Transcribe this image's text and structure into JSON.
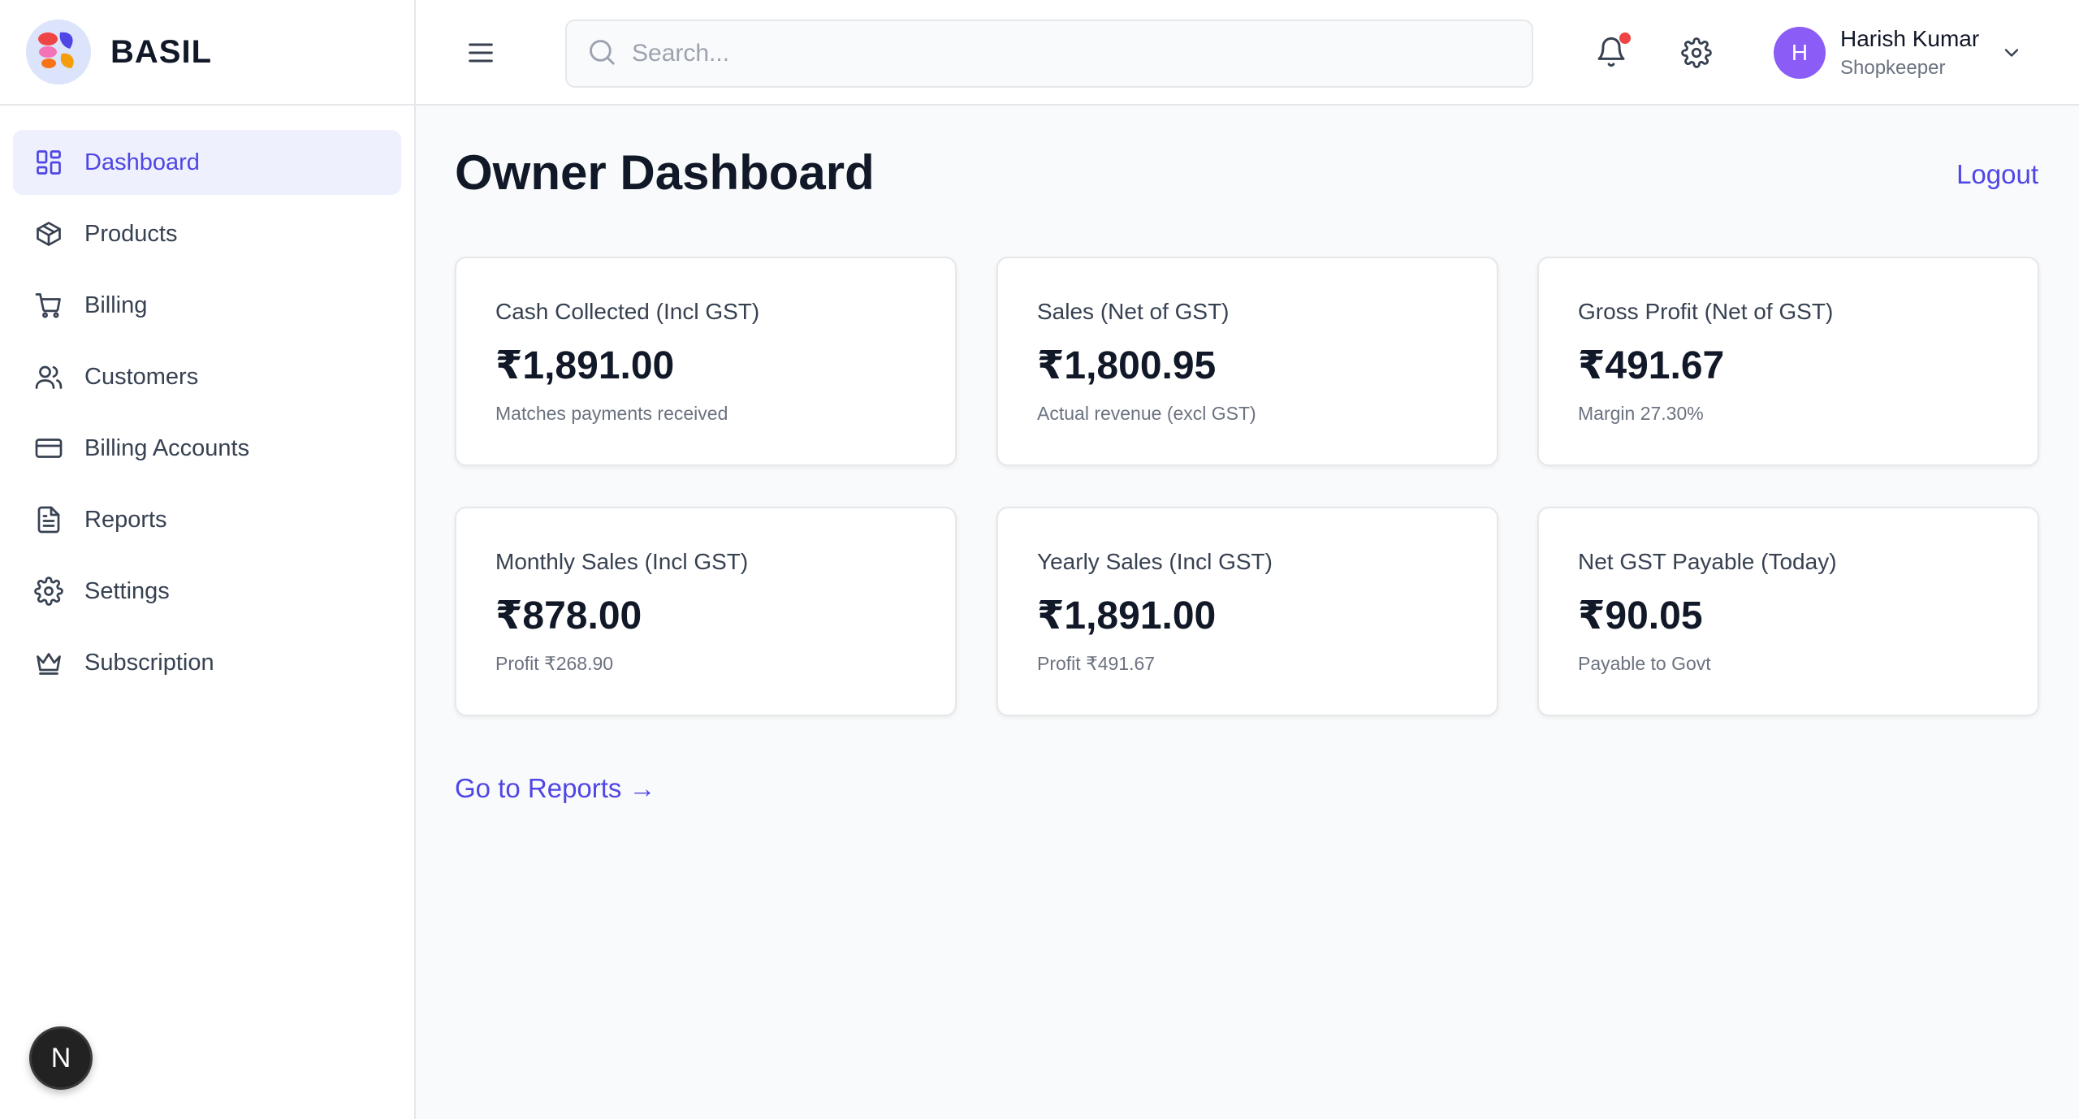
{
  "brand": {
    "name": "BASIL"
  },
  "sidebar": {
    "items": [
      {
        "label": "Dashboard",
        "icon": "dashboard-grid-icon",
        "active": true
      },
      {
        "label": "Products",
        "icon": "box-icon"
      },
      {
        "label": "Billing",
        "icon": "cart-icon"
      },
      {
        "label": "Customers",
        "icon": "users-icon"
      },
      {
        "label": "Billing Accounts",
        "icon": "credit-card-icon"
      },
      {
        "label": "Reports",
        "icon": "document-icon"
      },
      {
        "label": "Settings",
        "icon": "gear-icon"
      },
      {
        "label": "Subscription",
        "icon": "crown-icon"
      }
    ]
  },
  "dev_badge": {
    "letter": "N"
  },
  "topbar": {
    "search_placeholder": "Search...",
    "user": {
      "initial": "H",
      "name": "Harish Kumar",
      "role": "Shopkeeper"
    }
  },
  "main": {
    "title": "Owner Dashboard",
    "logout_label": "Logout",
    "cards": [
      {
        "label": "Cash Collected (Incl GST)",
        "value": "₹1,891.00",
        "sub": "Matches payments received"
      },
      {
        "label": "Sales (Net of GST)",
        "value": "₹1,800.95",
        "sub": "Actual revenue (excl GST)"
      },
      {
        "label": "Gross Profit (Net of GST)",
        "value": "₹491.67",
        "sub": "Margin 27.30%"
      },
      {
        "label": "Monthly Sales (Incl GST)",
        "value": "₹878.00",
        "sub": "Profit ₹268.90"
      },
      {
        "label": "Yearly Sales (Incl GST)",
        "value": "₹1,891.00",
        "sub": "Profit ₹491.67"
      },
      {
        "label": "Net GST Payable (Today)",
        "value": "₹90.05",
        "sub": "Payable to Govt"
      }
    ],
    "reports_link": "Go to Reports →"
  },
  "colors": {
    "accent": "#4f46e5",
    "avatar": "#8b5cf6",
    "notification": "#ef4444"
  }
}
